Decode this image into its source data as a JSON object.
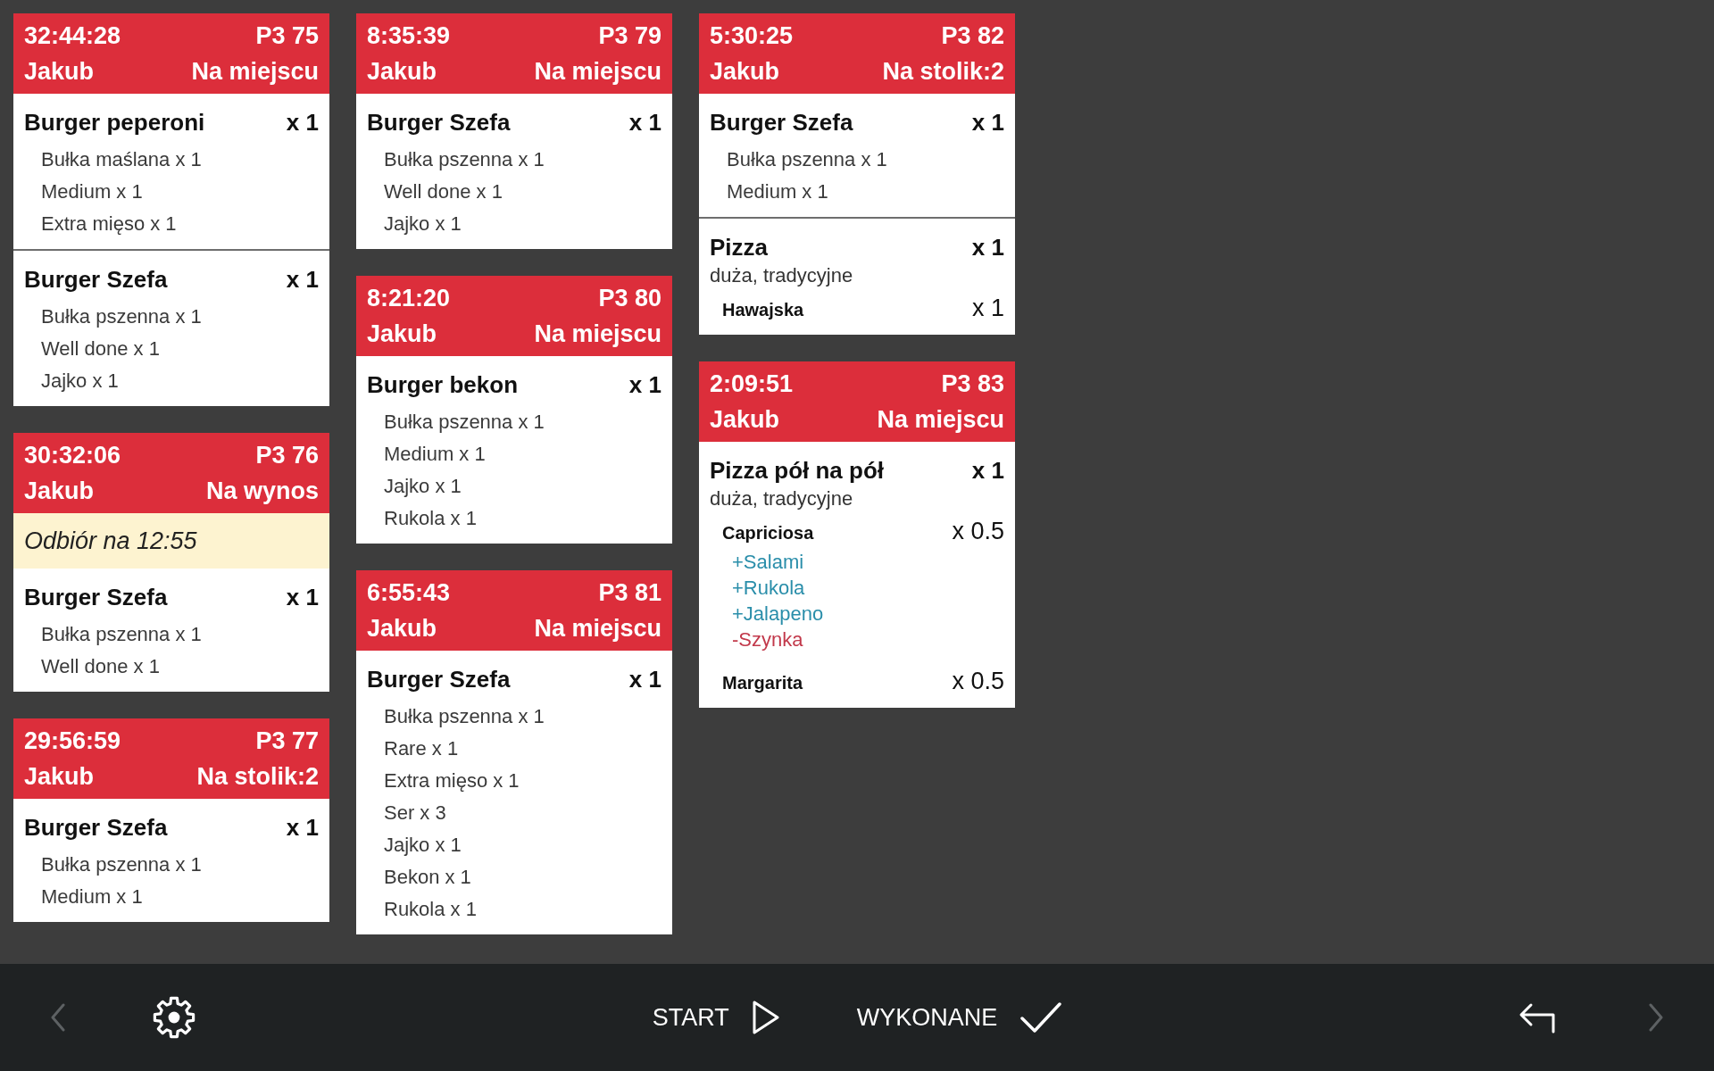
{
  "columns": [
    {
      "tickets": [
        {
          "elapsed": "32:44:28",
          "order_number": "P3 75",
          "waiter": "Jakub",
          "service": "Na miejscu",
          "items": [
            {
              "kind": "dish",
              "name": "Burger peperoni",
              "quantity": "x 1",
              "modifiers": [
                "Bułka maślana x 1",
                "Medium x 1",
                "Extra mięso x 1"
              ]
            },
            {
              "kind": "dish",
              "name": "Burger Szefa",
              "quantity": "x 1",
              "modifiers": [
                "Bułka pszenna x 1",
                "Well done x 1",
                "Jajko x 1"
              ]
            }
          ]
        },
        {
          "elapsed": "30:32:06",
          "order_number": "P3 76",
          "waiter": "Jakub",
          "service": "Na wynos",
          "note": "Odbiór na 12:55",
          "items": [
            {
              "kind": "dish",
              "name": "Burger Szefa",
              "quantity": "x 1",
              "modifiers": [
                "Bułka pszenna x 1",
                "Well done x 1"
              ]
            }
          ]
        },
        {
          "elapsed": "29:56:59",
          "order_number": "P3 77",
          "waiter": "Jakub",
          "service": "Na stolik:2",
          "items": [
            {
              "kind": "dish",
              "name": "Burger Szefa",
              "quantity": "x 1",
              "modifiers": [
                "Bułka pszenna x 1",
                "Medium x 1"
              ]
            }
          ]
        }
      ]
    },
    {
      "tickets": [
        {
          "elapsed": "8:35:39",
          "order_number": "P3 79",
          "waiter": "Jakub",
          "service": "Na miejscu",
          "items": [
            {
              "kind": "dish",
              "name": "Burger Szefa",
              "quantity": "x 1",
              "modifiers": [
                "Bułka pszenna x 1",
                "Well done x 1",
                "Jajko x 1"
              ]
            }
          ]
        },
        {
          "elapsed": "8:21:20",
          "order_number": "P3 80",
          "waiter": "Jakub",
          "service": "Na miejscu",
          "items": [
            {
              "kind": "dish",
              "name": "Burger bekon",
              "quantity": "x 1",
              "modifiers": [
                "Bułka pszenna x 1",
                "Medium x 1",
                "Jajko x 1",
                "Rukola x 1"
              ]
            }
          ]
        },
        {
          "elapsed": "6:55:43",
          "order_number": "P3 81",
          "waiter": "Jakub",
          "service": "Na miejscu",
          "items": [
            {
              "kind": "dish",
              "name": "Burger Szefa",
              "quantity": "x 1",
              "modifiers": [
                "Bułka pszenna x 1",
                "Rare x 1",
                "Extra mięso x 1",
                "Ser x 3",
                "Jajko x 1",
                "Bekon x 1",
                "Rukola x 1"
              ]
            }
          ]
        }
      ]
    },
    {
      "tickets": [
        {
          "elapsed": "5:30:25",
          "order_number": "P3 82",
          "waiter": "Jakub",
          "service": "Na stolik:2",
          "items": [
            {
              "kind": "dish",
              "name": "Burger Szefa",
              "quantity": "x 1",
              "modifiers": [
                "Bułka pszenna x 1",
                "Medium x 1"
              ]
            },
            {
              "kind": "pizza",
              "name": "Pizza",
              "quantity": "x 1",
              "description": "duża, tradycyjne",
              "parts": [
                {
                  "name": "Hawajska",
                  "quantity": "x 1"
                }
              ]
            }
          ]
        },
        {
          "elapsed": "2:09:51",
          "order_number": "P3 83",
          "waiter": "Jakub",
          "service": "Na miejscu",
          "items": [
            {
              "kind": "pizza",
              "name": "Pizza pół na pół",
              "quantity": "x 1",
              "description": "duża, tradycyjne",
              "parts": [
                {
                  "name": "Capriciosa",
                  "quantity": "x 0.5",
                  "toppings": [
                    {
                      "kind": "added",
                      "text": "+Salami"
                    },
                    {
                      "kind": "added",
                      "text": "+Rukola"
                    },
                    {
                      "kind": "added",
                      "text": "+Jalapeno"
                    },
                    {
                      "kind": "removed",
                      "text": "-Szynka"
                    }
                  ]
                },
                {
                  "name": "Margarita",
                  "quantity": "x 0.5"
                }
              ]
            }
          ]
        }
      ]
    }
  ],
  "toolbar": {
    "left": [
      {
        "kind": "prev",
        "disabled": true
      },
      {
        "kind": "settings",
        "disabled": false
      }
    ],
    "center": [
      {
        "kind": "start",
        "label": "START",
        "disabled": false
      },
      {
        "kind": "done",
        "label": "WYKONANE",
        "disabled": false
      }
    ],
    "right": [
      {
        "kind": "undo",
        "disabled": false
      },
      {
        "kind": "next",
        "disabled": true
      }
    ]
  }
}
